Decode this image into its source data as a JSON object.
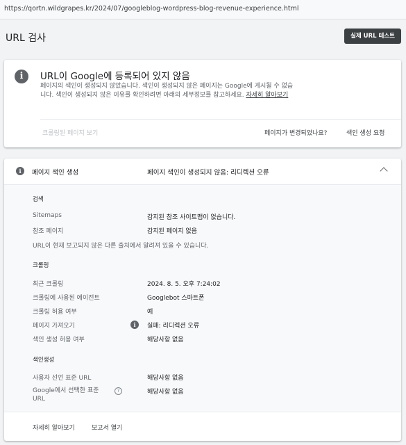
{
  "url": "https://qortn.wildgrapes.kr/2024/07/googleblog-wordpress-blog-revenue-experience.html",
  "header": {
    "title": "URL 검사",
    "live_test_label": "실제 URL 테스트"
  },
  "status_card": {
    "title": "URL이 Google에 등록되어 있지 않음",
    "description": "페이지의 색인이 생성되지 않았습니다. 색인이 생성되지 않은 페이지는 Google에 게시될 수 없습니다. 색인이 생성되지 않은 이유를 확인하려면 아래의 세부정보를 참고하세요.",
    "learn_more": "자세히 알아보기",
    "crawled_page_label": "크롤링된 페이지 보기",
    "page_changed_label": "페이지가 변경되었나요?",
    "request_indexing_label": "색인 생성 요청"
  },
  "indexing_card": {
    "label": "페이지 색인 생성",
    "status": "페이지 색인이 생성되지 않음: 리디렉션 오류",
    "discovery": {
      "heading": "검색",
      "sitemaps_label": "Sitemaps",
      "sitemaps_value": "감지된 참조 사이트맵이 없습니다.",
      "referring_label": "참조 페이지",
      "referring_value": "감지된 페이지 없음",
      "note": "URL이 현재 보고되지 않은 다른 출처에서 알려져 있을 수 있습니다."
    },
    "crawl": {
      "heading": "크롤링",
      "last_crawl_label": "최근 크롤링",
      "last_crawl_value": "2024. 8. 5. 오후 7:24:02",
      "crawled_as_label": "크롤링에 사용된 에이전트",
      "crawled_as_value": "Googlebot 스마트폰",
      "crawl_allowed_label": "크롤링 허용 여부",
      "crawl_allowed_value": "예",
      "page_fetch_label": "페이지 가져오기",
      "page_fetch_value": "실패: 리디렉션 오류",
      "indexing_allowed_label": "색인 생성 허용 여부",
      "indexing_allowed_value": "해당사항 없음"
    },
    "indexing": {
      "heading": "색인생성",
      "user_canonical_label": "사용자 선언 표준 URL",
      "user_canonical_value": "해당사항 없음",
      "google_canonical_label": "Google에서 선택한 표준 URL",
      "google_canonical_value": "해당사항 없음"
    },
    "footer": {
      "learn_more": "자세히 알아보기",
      "open_report": "보고서 열기"
    }
  },
  "icons": {
    "info": "info-icon",
    "help": "help-icon",
    "chevron": "chevron-up-icon"
  },
  "colors": {
    "button_dark": "#3c4043",
    "background": "#f1f3f4",
    "card": "#ffffff",
    "muted_text": "#5f6368"
  }
}
